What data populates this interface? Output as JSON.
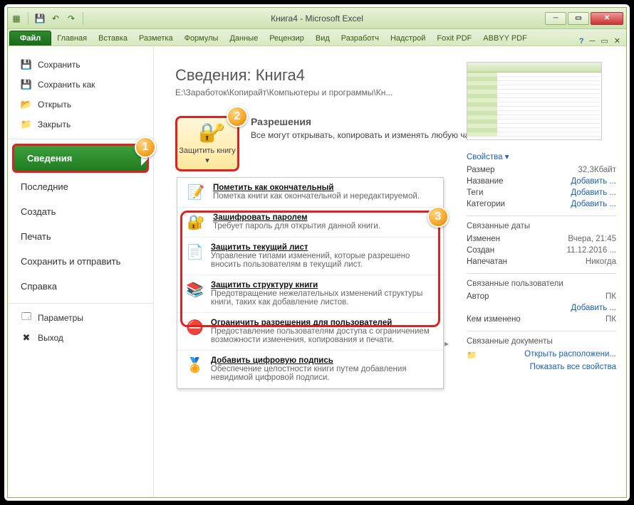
{
  "window": {
    "title": "Книга4  -  Microsoft Excel"
  },
  "ribbon": {
    "file": "Файл",
    "tabs": [
      "Главная",
      "Вставка",
      "Разметка",
      "Формулы",
      "Данные",
      "Рецензир",
      "Вид",
      "Разработч",
      "Надстрой",
      "Foxit PDF",
      "ABBYY PDF"
    ]
  },
  "sidebar": {
    "top": [
      {
        "icon": "💾",
        "label": "Сохранить"
      },
      {
        "icon": "💾",
        "label": "Сохранить как"
      },
      {
        "icon": "📂",
        "label": "Открыть"
      },
      {
        "icon": "📁",
        "label": "Закрыть"
      }
    ],
    "mid": [
      {
        "label": "Сведения",
        "selected": true
      },
      {
        "label": "Последние"
      },
      {
        "label": "Создать"
      },
      {
        "label": "Печать"
      },
      {
        "label": "Сохранить и отправить"
      },
      {
        "label": "Справка"
      }
    ],
    "bot": [
      {
        "icon": "⚙",
        "label": "Параметры"
      },
      {
        "icon": "�otimes",
        "label": "Выход"
      }
    ]
  },
  "badges": {
    "one": "1",
    "two": "2",
    "three": "3"
  },
  "content": {
    "title": "Сведения: Книга4",
    "path": "E:\\Заработок\\Копирайт\\Компьютеры и программы\\Кн...",
    "protect_label": "Защитить книгу ▾",
    "permissions": {
      "hdr": "Разрешения",
      "txt": "Все могут открывать, копировать и изменять любую часть этой книги."
    },
    "menu": [
      {
        "icon": "📝",
        "t": "Пометить как окончательный",
        "d": "Пометка книги как окончательной и нередактируемой."
      },
      {
        "icon": "🔐",
        "t": "Зашифровать паролем",
        "d": "Требует пароль для открытия данной книги."
      },
      {
        "icon": "📄",
        "t": "Защитить текущий лист",
        "d": "Управление типами изменений, которые разрешено вносить пользователям в текущий лист."
      },
      {
        "icon": "📚",
        "t": "Защитить структуру книги",
        "d": "Предотвращение нежелательных изменений структуры книги, таких как добавление листов."
      },
      {
        "icon": "⛔",
        "t": "Ограничить разрешения для пользователей",
        "d": "Предоставление пользователям доступа с ограничением возможности изменения, копирования и печати."
      },
      {
        "icon": "🏅",
        "t": "Добавить цифровую подпись",
        "d": "Обеспечение целостности книги путем добавления невидимой цифровой подписи."
      }
    ]
  },
  "props": {
    "header": "Свойства ▾",
    "rows1": [
      {
        "k": "Размер",
        "v": "32,3Кбайт"
      },
      {
        "k": "Название",
        "v": "Добавить ...",
        "link": true
      },
      {
        "k": "Теги",
        "v": "Добавить ...",
        "link": true
      },
      {
        "k": "Категории",
        "v": "Добавить ...",
        "link": true
      }
    ],
    "dates_h": "Связанные даты",
    "rows2": [
      {
        "k": "Изменен",
        "v": "Вчера, 21:45"
      },
      {
        "k": "Создан",
        "v": "11.12.2016 ..."
      },
      {
        "k": "Напечатан",
        "v": "Никогда"
      }
    ],
    "users_h": "Связанные пользователи",
    "rows3": [
      {
        "k": "Автор",
        "v": "ПК"
      },
      {
        "k": "",
        "v": "Добавить ...",
        "link": true
      },
      {
        "k": "Кем изменено",
        "v": "ПК"
      }
    ],
    "docs_h": "Связанные документы",
    "open_loc": "Открыть расположени...",
    "all_props": "Показать все свойства"
  }
}
